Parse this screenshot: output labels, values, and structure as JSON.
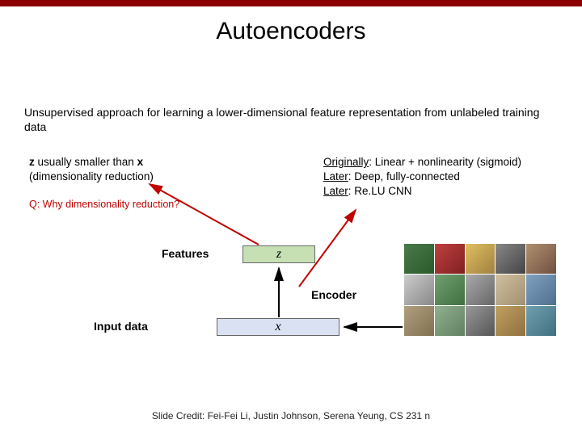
{
  "title": "Autoencoders",
  "subtitle": "Unsupervised approach for learning a lower-dimensional feature representation from unlabeled training data",
  "note_z_1": "z",
  "note_z_2": " usually smaller than ",
  "note_z_3": "x",
  "note_z_4": " (dimensionality reduction)",
  "note_q": "Q: Why dimensionality reduction?",
  "orig_1a": "Originally",
  "orig_1b": ": Linear + nonlinearity (sigmoid)",
  "orig_2a": "Later",
  "orig_2b": ": Deep, fully-connected",
  "orig_3a": "Later",
  "orig_3b": ": Re.LU CNN",
  "features_label": "Features",
  "encoder_label": "Encoder",
  "input_label": "Input data",
  "z_symbol": "z",
  "x_symbol": "x",
  "credit": "Slide Credit: Fei-Fei Li, Justin Johnson, Serena Yeung, CS 231 n"
}
